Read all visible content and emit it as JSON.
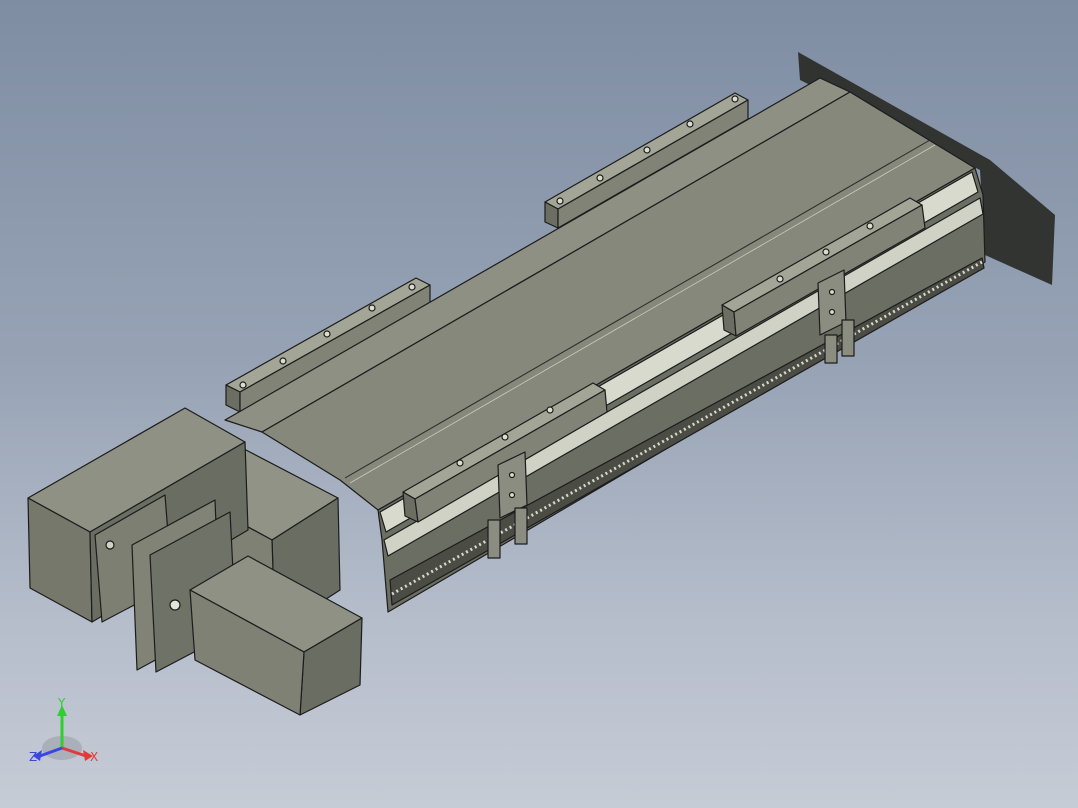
{
  "view": {
    "background_top": "#7f8da3",
    "background_bottom": "#c6ccd6",
    "model_face_light": "#8f9284",
    "model_face_mid": "#7e8174",
    "model_face_dark": "#5f6257",
    "edge_color": "#1c1c1c"
  },
  "triad": {
    "x_label": "X",
    "y_label": "Y",
    "z_label": "Z",
    "x_color": "#e03a3a",
    "y_color": "#2fcf2f",
    "z_color": "#3a46e0",
    "icon": "coordinate-triad-icon"
  }
}
